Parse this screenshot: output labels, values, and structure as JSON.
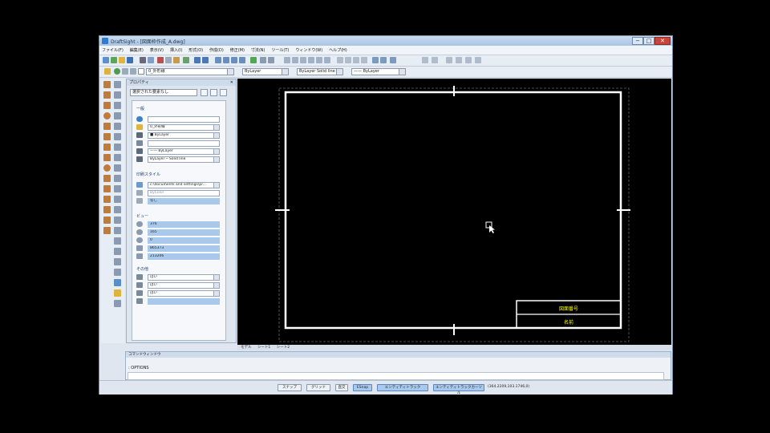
{
  "window": {
    "title": "DraftSight - [図面枠作成_A.dwg]",
    "controls": {
      "minimize": "−",
      "maximize": "□",
      "close": "✕"
    }
  },
  "menu": {
    "items": [
      "ファイル(F)",
      "編集(E)",
      "表示(V)",
      "挿入(I)",
      "形式(O)",
      "作成(D)",
      "修正(M)",
      "寸法(N)",
      "ツール(T)",
      "ウィンドウ(W)",
      "ヘルプ(H)"
    ]
  },
  "toolbar2": {
    "layer_combo": "0_外形線",
    "color_combo": "ByLayer",
    "linestyle_combo": "ByLayer",
    "linestyle_type": "Solid line",
    "lineweight_combo": "—— ByLayer"
  },
  "properties": {
    "title": "プロパティ",
    "close": "✕",
    "selection": "選択された要素なし",
    "sections": {
      "general": "一般",
      "print_style": "印刷スタイル",
      "view": "ビュー",
      "misc": "その他"
    },
    "general_fields": [
      "",
      "0_外形線",
      "■ ByLayer",
      "",
      "—— ByLayer",
      "ByLayer ─ Solid line"
    ],
    "print_fields": [
      "c:\\documents and settings\\pr...",
      "ByColor",
      "なし"
    ],
    "view_fields": [
      "376",
      "165",
      "0",
      "865373",
      "213206"
    ],
    "misc_fields": [
      "はい",
      "はい",
      "はい",
      ""
    ]
  },
  "drawing": {
    "title_block_row1": "図面番号",
    "title_block_row2": "名前",
    "text_color": "#ffff00"
  },
  "tabs": [
    "モデル",
    "シート1",
    "シート2"
  ],
  "command": {
    "title": "コマンドウィンドウ",
    "history_line": ": OPTIONS"
  },
  "status": {
    "buttons": [
      "スナップ",
      "グリッド",
      "直交",
      "ESnap",
      "エンティティトラック",
      "エンティティトラックカーソル"
    ],
    "active": [
      false,
      false,
      false,
      true,
      true,
      true
    ],
    "coords": "(364.2209,103.1746,0)"
  },
  "colors": {
    "frame_bg": "#dfe6ef",
    "canvas_bg": "#000000",
    "selection": "#a9c9ec",
    "border_line": "#ffffff"
  }
}
